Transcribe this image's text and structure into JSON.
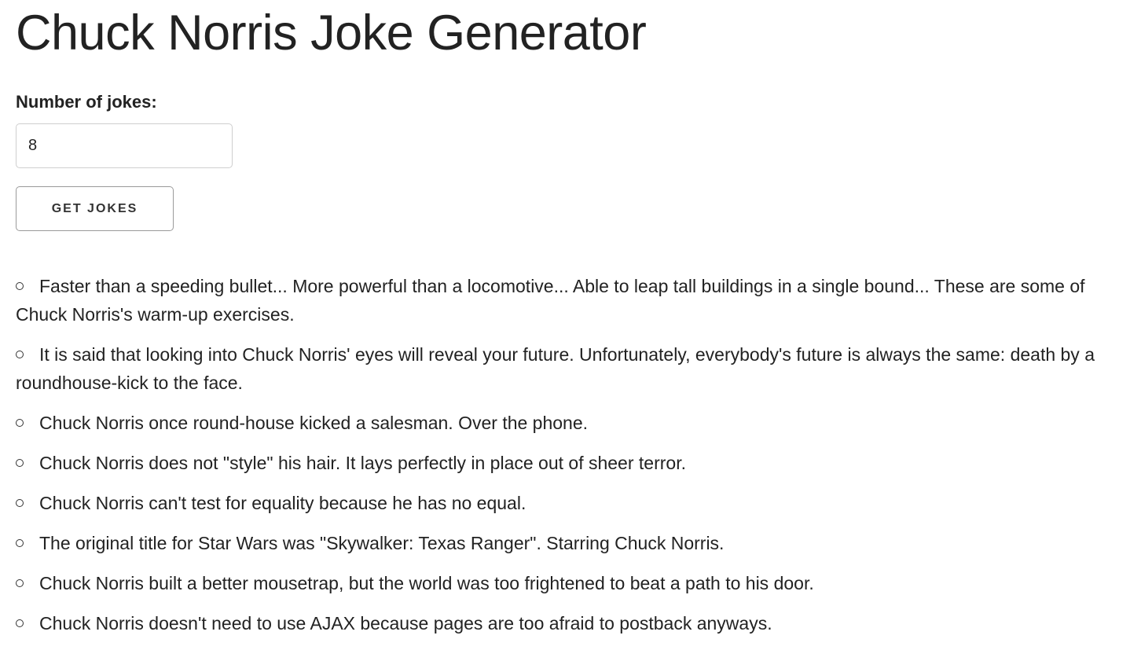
{
  "header": {
    "title": "Chuck Norris Joke Generator"
  },
  "form": {
    "number_label": "Number of jokes:",
    "number_value": "8",
    "button_label": "GET JOKES"
  },
  "jokes": [
    "Faster than a speeding bullet... More powerful than a locomotive... Able to leap tall buildings in a single bound... These are some of Chuck Norris's warm-up exercises.",
    "It is said that looking into Chuck Norris' eyes will reveal your future. Unfortunately, everybody's future is always the same: death by a roundhouse-kick to the face.",
    "Chuck Norris once round-house kicked a salesman. Over the phone.",
    "Chuck Norris does not \"style\" his hair. It lays perfectly in place out of sheer terror.",
    "Chuck Norris can't test for equality because he has no equal.",
    "The original title for Star Wars was \"Skywalker: Texas Ranger\". Starring Chuck Norris.",
    "Chuck Norris built a better mousetrap, but the world was too frightened to beat a path to his door.",
    "Chuck Norris doesn't need to use AJAX because pages are too afraid to postback anyways."
  ],
  "icons": {
    "list_bullet": "hollow-circle-bullet-icon"
  }
}
